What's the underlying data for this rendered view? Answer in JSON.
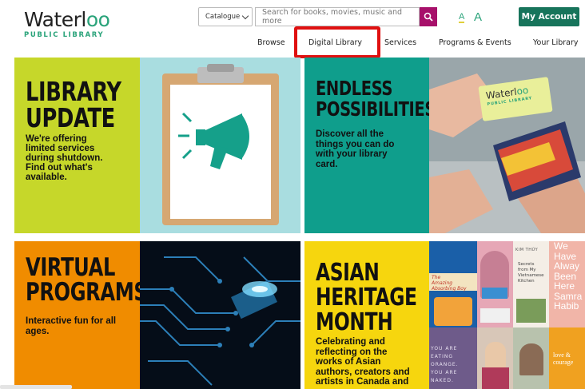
{
  "header": {
    "logo_main": "Waterl",
    "logo_oo": "oo",
    "logo_sub": "PUBLIC LIBRARY",
    "catalogue_select": "Catalogue",
    "search_placeholder": "Search for books, movies, music and more",
    "font_small": "A",
    "font_large": "A",
    "my_account": "My Account"
  },
  "nav": {
    "items": [
      {
        "label": "Browse"
      },
      {
        "label": "Digital Library"
      },
      {
        "label": "Services"
      },
      {
        "label": "Programs & Events"
      },
      {
        "label": "Your Library"
      }
    ]
  },
  "tiles": [
    {
      "heading": [
        "LIBRARY",
        "UPDATE"
      ],
      "body": [
        "We're offering",
        "limited services",
        "during shutdown.",
        "Find out what's",
        "available."
      ],
      "color": "#c6d72a",
      "image_icon": "megaphone-clipboard-icon"
    },
    {
      "heading": [
        "ENDLESS",
        "POSSIBILITIES"
      ],
      "body": [
        "Discover all the",
        "things you can do",
        "with your library",
        "card."
      ],
      "color": "#0f9e8c",
      "card_main": "Waterl",
      "card_oo": "oo",
      "card_sub": "PUBLIC LIBRARY"
    },
    {
      "heading": [
        "VIRTUAL",
        "PROGRAMS"
      ],
      "body": [
        "Interactive fun for all",
        "ages."
      ],
      "color": "#f08c00",
      "image_icon": "circuit-board-icon"
    },
    {
      "heading": [
        "ASIAN",
        "HERITAGE",
        "MONTH"
      ],
      "body": [
        "Celebrating and",
        "reflecting on the",
        "works of Asian",
        "authors, creators and",
        "artists in Canada and"
      ],
      "color": "#f6d60e"
    }
  ],
  "books": {
    "book1": [
      "The",
      "Amazing Absorbing Boy"
    ],
    "book2_author": "KIM THÚY",
    "book2_title": [
      "Secrets",
      "from My",
      "Vietnamese",
      "Kitchen"
    ],
    "book3": [
      "We",
      "Have",
      "Alway",
      "Been",
      "Here",
      "Samra",
      "Habib"
    ],
    "book4": [
      "YOU ARE",
      "EATING",
      "ORANGE.",
      "YOU ARE",
      "NAKED."
    ],
    "book6": [
      "love &",
      "courage"
    ]
  },
  "colors": {
    "accent_green": "#17745b",
    "search_magenta": "#a7106a",
    "highlight_red": "#e01010"
  }
}
